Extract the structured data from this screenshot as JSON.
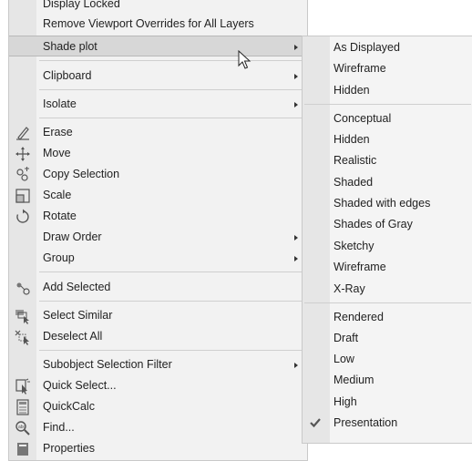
{
  "main_menu": {
    "items": [
      {
        "label": "Display Locked"
      },
      {
        "label": "Remove Viewport Overrides for All Layers"
      },
      {
        "label": "Shade plot"
      },
      {
        "label": "Clipboard"
      },
      {
        "label": "Isolate"
      },
      {
        "label": "Erase",
        "icon": "erase-icon"
      },
      {
        "label": "Move",
        "icon": "move-icon"
      },
      {
        "label": "Copy Selection",
        "icon": "copy-selection-icon"
      },
      {
        "label": "Scale",
        "icon": "scale-icon"
      },
      {
        "label": "Rotate",
        "icon": "rotate-icon"
      },
      {
        "label": "Draw Order"
      },
      {
        "label": "Group"
      },
      {
        "label": "Add Selected",
        "icon": "add-selected-icon"
      },
      {
        "label": "Select Similar",
        "icon": "select-similar-icon"
      },
      {
        "label": "Deselect All",
        "icon": "deselect-all-icon"
      },
      {
        "label": "Subobject Selection Filter"
      },
      {
        "label": "Quick Select...",
        "icon": "quick-select-icon"
      },
      {
        "label": "QuickCalc",
        "icon": "calculator-icon"
      },
      {
        "label": "Find...",
        "icon": "find-icon"
      },
      {
        "label": "Properties",
        "icon": "properties-icon"
      }
    ]
  },
  "shade_plot_menu": {
    "items": [
      {
        "label": "As Displayed"
      },
      {
        "label": "Wireframe"
      },
      {
        "label": "Hidden"
      },
      {
        "label": "Conceptual"
      },
      {
        "label": "Hidden"
      },
      {
        "label": "Realistic"
      },
      {
        "label": "Shaded"
      },
      {
        "label": "Shaded with edges"
      },
      {
        "label": "Shades of Gray"
      },
      {
        "label": "Sketchy"
      },
      {
        "label": "Wireframe"
      },
      {
        "label": "X-Ray"
      },
      {
        "label": "Rendered"
      },
      {
        "label": "Draft"
      },
      {
        "label": "Low"
      },
      {
        "label": "Medium"
      },
      {
        "label": "High"
      },
      {
        "label": "Presentation",
        "checked": true
      }
    ]
  },
  "colors": {
    "menu_bg": "#f2f2f2",
    "gutter": "#e6e6e6",
    "highlight": "#d7d7d7"
  }
}
